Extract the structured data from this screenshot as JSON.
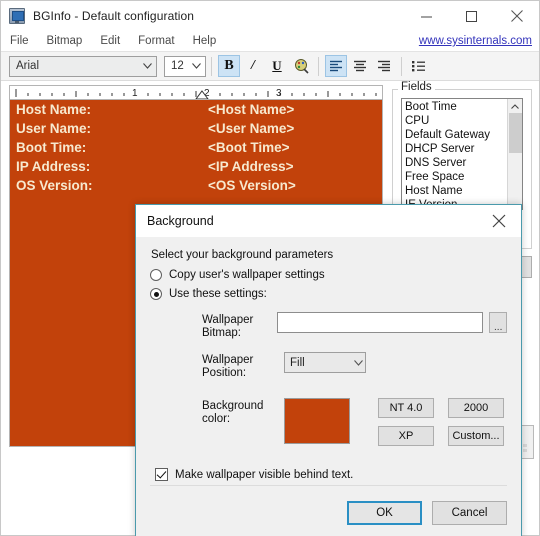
{
  "window": {
    "title": "BGInfo - Default configuration",
    "icon": "monitor-icon",
    "minimize_label": "Minimize",
    "maximize_label": "Maximize",
    "close_label": "Close"
  },
  "menu": {
    "items": [
      "File",
      "Bitmap",
      "Edit",
      "Format",
      "Help"
    ],
    "link": "www.sysinternals.com"
  },
  "toolbar": {
    "font_name": "Arial",
    "font_size": "12",
    "bold_label": "B",
    "italic_label": "I",
    "underline_label": "U",
    "color_label": "Text color",
    "align_left_label": "Align left",
    "align_center_label": "Align center",
    "align_right_label": "Align right",
    "bullets_label": "Bullets"
  },
  "ruler": {
    "marks": [
      "1",
      "2",
      "3"
    ]
  },
  "editor": {
    "background_color": "#c2420b",
    "text_color": "#f7e9cf",
    "rows": [
      {
        "label": "Host Name:",
        "value": "<Host Name>"
      },
      {
        "label": "User Name:",
        "value": "<User Name>"
      },
      {
        "label": "Boot Time:",
        "value": "<Boot Time>"
      },
      {
        "label": "IP Address:",
        "value": "<IP Address>"
      },
      {
        "label": "OS Version:",
        "value": "<OS Version>"
      }
    ]
  },
  "fields": {
    "legend": "Fields",
    "items": [
      "Boot Time",
      "CPU",
      "Default Gateway",
      "DHCP Server",
      "DNS Server",
      "Free Space",
      "Host Name",
      "IE Version"
    ]
  },
  "dialog": {
    "title": "Background",
    "close_label": "Close",
    "hint": "Select your background parameters",
    "radio_copy": {
      "label": "Copy user's wallpaper settings",
      "checked": false
    },
    "radio_use": {
      "label": "Use these settings:",
      "checked": true
    },
    "wallpaper_bitmap": {
      "label": "Wallpaper Bitmap:",
      "value": "",
      "placeholder": "",
      "browse_label": "..."
    },
    "wallpaper_position": {
      "label": "Wallpaper Position:",
      "value": "Fill"
    },
    "background_color": {
      "label": "Background color:",
      "swatch": "#c2420b"
    },
    "presets": [
      "NT 4.0",
      "2000",
      "XP",
      "Custom..."
    ],
    "checkbox": {
      "label": "Make wallpaper visible behind text.",
      "checked": true
    },
    "ok_label": "OK",
    "cancel_label": "Cancel"
  }
}
